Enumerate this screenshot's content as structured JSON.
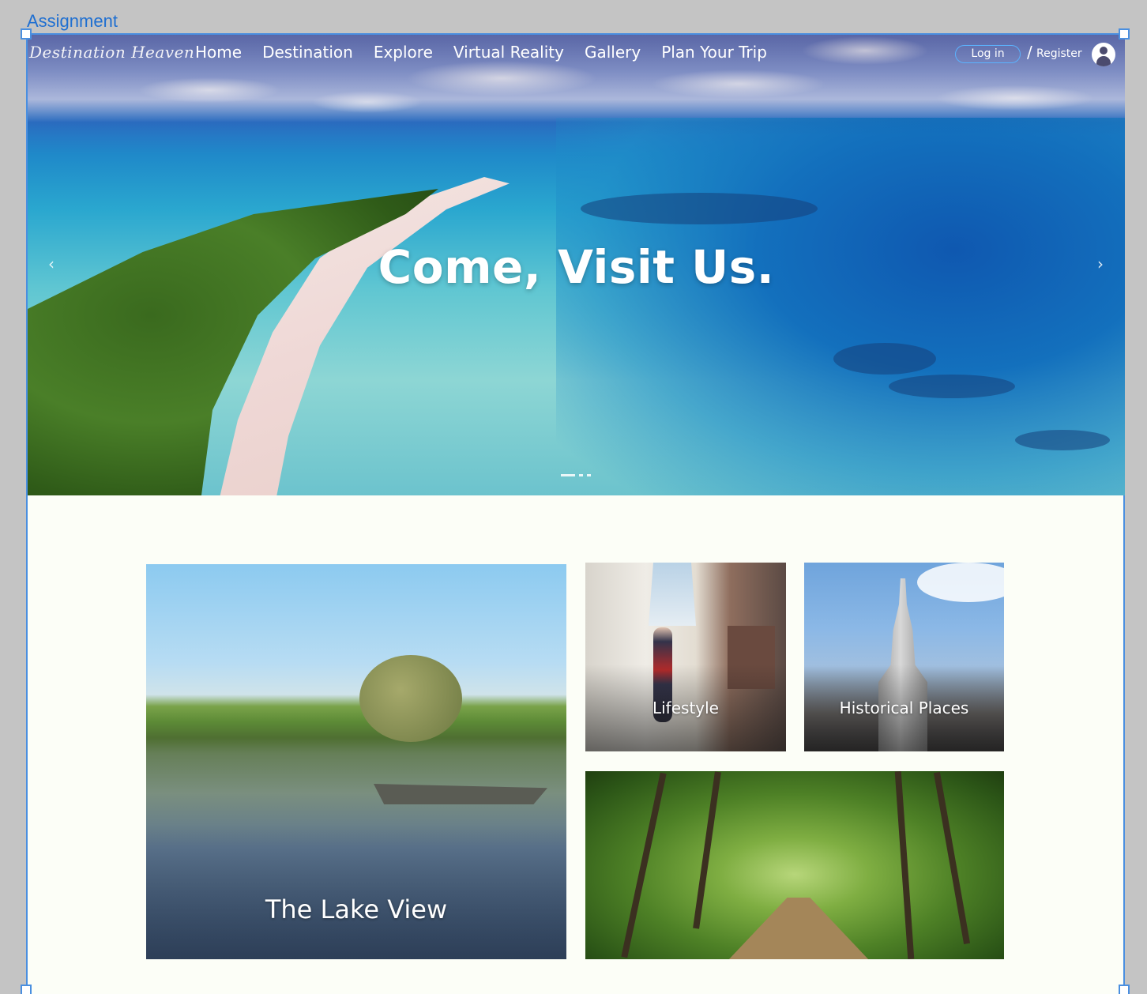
{
  "artboard": {
    "label": "Assignment"
  },
  "nav": {
    "logo": "Destination Heaven",
    "links": [
      "Home",
      "Destination",
      "Explore",
      "Virtual Reality",
      "Gallery",
      "Plan Your Trip"
    ],
    "login": "Log in",
    "separator": "/",
    "register": "Register"
  },
  "hero": {
    "title": "Come, Visit Us.",
    "prev_arrow": "‹",
    "next_arrow": "›",
    "slide_count": 3,
    "active_slide": 1
  },
  "cards": {
    "lake": "The Lake View",
    "lifestyle": "Lifestyle",
    "historical": "Historical Places",
    "forest": ""
  },
  "colors": {
    "selection_blue": "#4a8fe0",
    "page_background": "#fcfef7",
    "canvas_gray": "#c4c4c4"
  }
}
